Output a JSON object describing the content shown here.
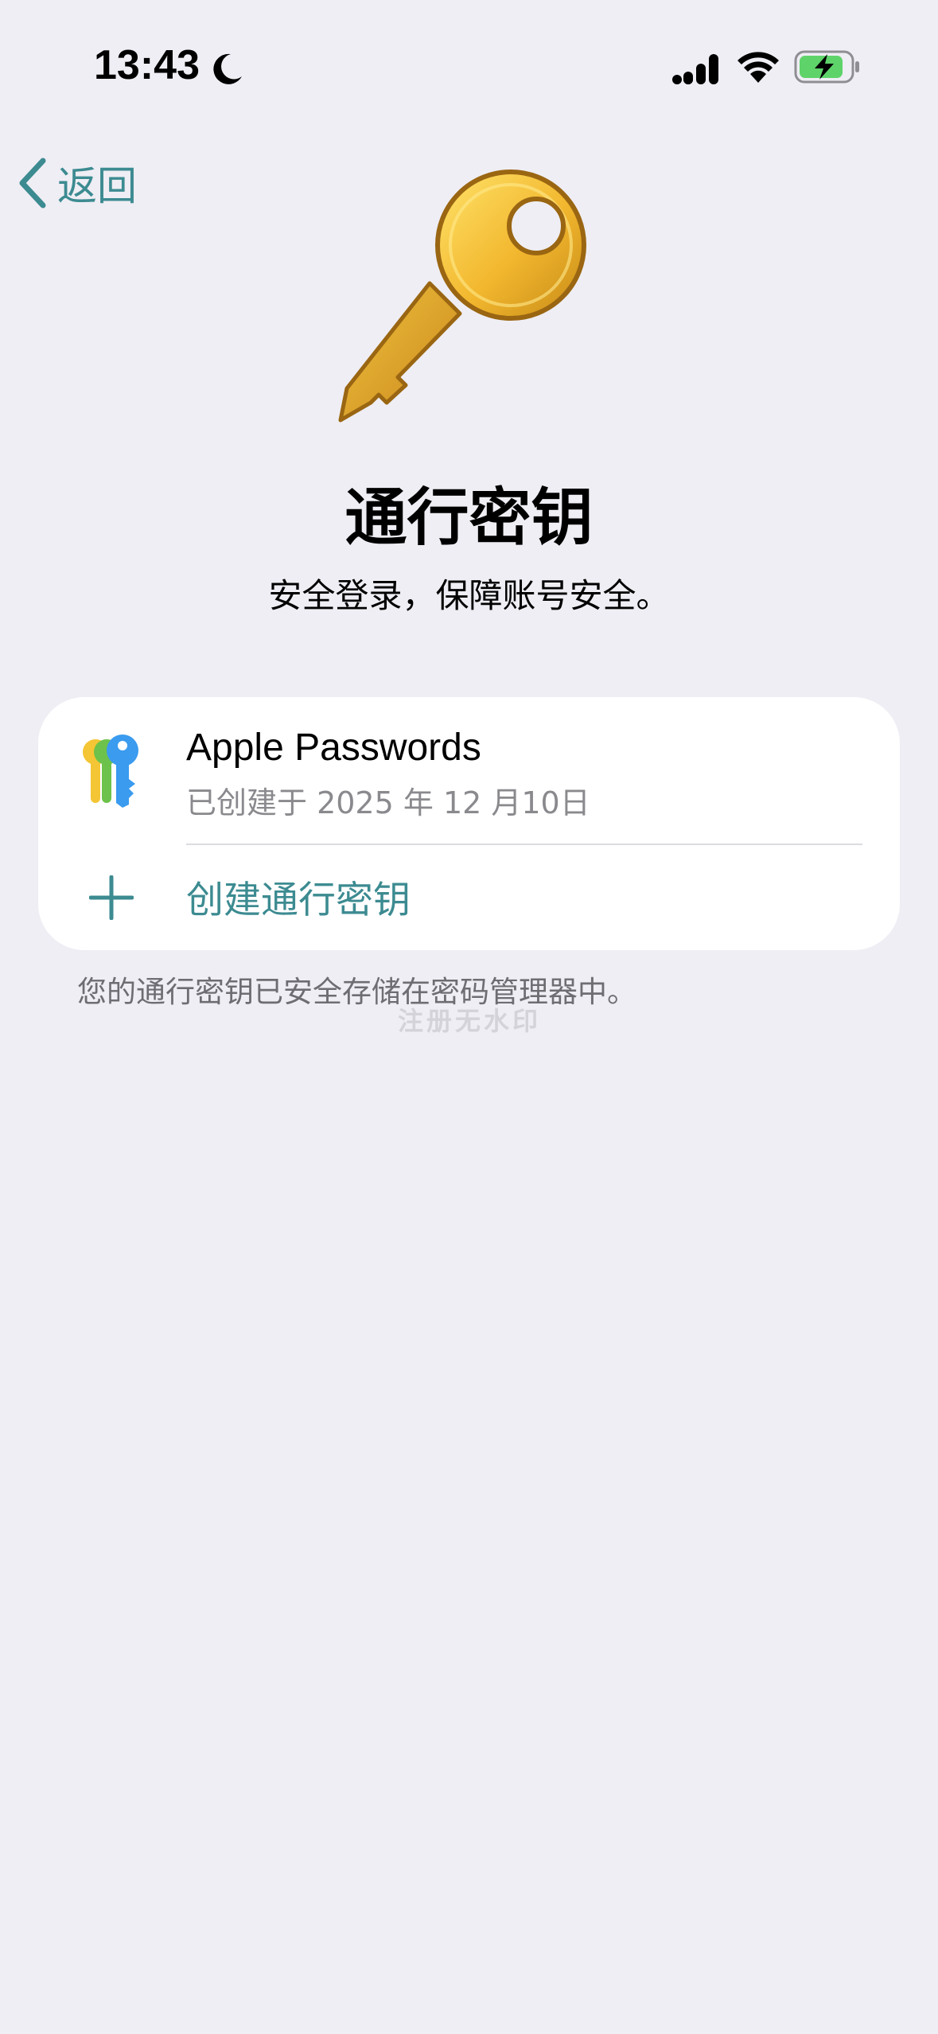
{
  "status_bar": {
    "time": "13:43",
    "icons": [
      "moon-icon",
      "cellular-signal-icon",
      "wifi-icon",
      "battery-charging-icon"
    ]
  },
  "nav": {
    "back_label": "返回"
  },
  "header": {
    "icon": "key-icon",
    "title": "通行密钥",
    "subtitle": "安全登录，保障账号安全。"
  },
  "passkey_card": {
    "entry": {
      "icon": "apple-passwords-icon",
      "name": "Apple Passwords",
      "created": "已创建于 2025 年 12 月10日"
    },
    "create_label": "创建通行密钥"
  },
  "footer_note": "您的通行密钥已安全存储在密码管理器中。",
  "watermark": "注册无水印",
  "colors": {
    "background": "#EFEEF4",
    "accent": "#3C8B91",
    "card": "#FFFFFF",
    "secondary_text": "#8A8A8E",
    "battery_green": "#5ED36A"
  }
}
